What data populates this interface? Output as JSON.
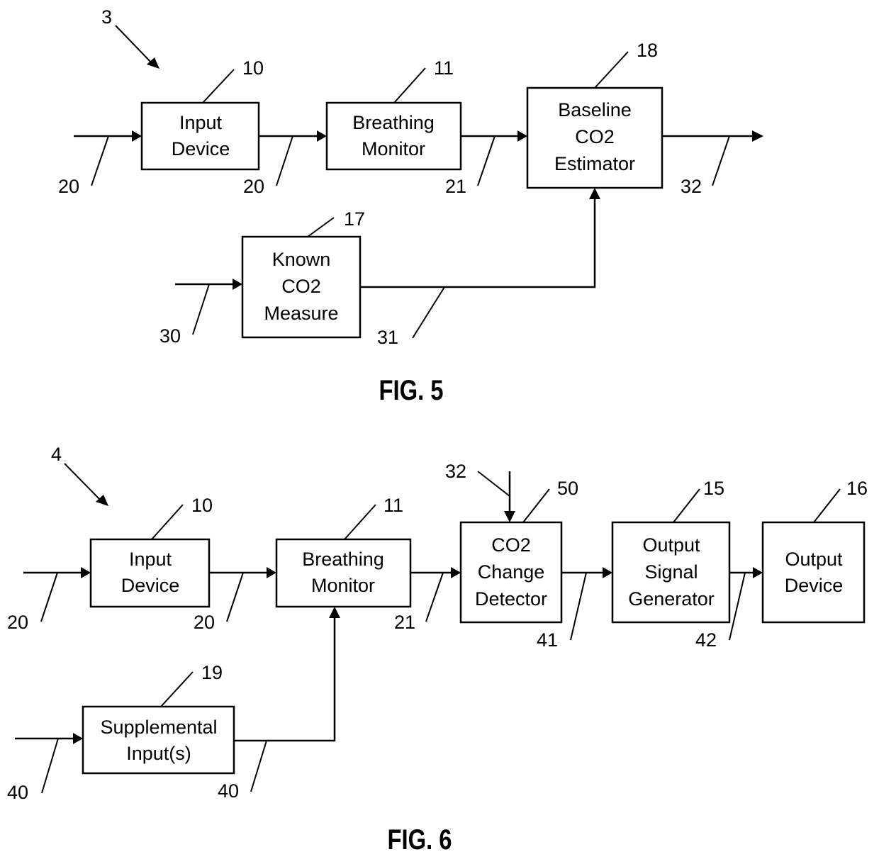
{
  "fig5": {
    "caption": "FIG. 5",
    "ref": "3",
    "blocks": {
      "input_device": {
        "ref": "10",
        "lines": [
          "Input",
          "Device"
        ]
      },
      "breathing_monitor": {
        "ref": "11",
        "lines": [
          "Breathing",
          "Monitor"
        ]
      },
      "baseline_estimator": {
        "ref": "18",
        "lines": [
          "Baseline",
          "CO2",
          "Estimator"
        ]
      },
      "known_co2": {
        "ref": "17",
        "lines": [
          "Known",
          "CO2",
          "Measure"
        ]
      }
    },
    "signals": {
      "in_input": "20",
      "input_to_monitor": "20",
      "monitor_to_estimator": "21",
      "estimator_out": "32",
      "in_known": "30",
      "known_to_estimator": "31"
    }
  },
  "fig6": {
    "caption": "FIG. 6",
    "ref": "4",
    "blocks": {
      "input_device": {
        "ref": "10",
        "lines": [
          "Input",
          "Device"
        ]
      },
      "breathing_monitor": {
        "ref": "11",
        "lines": [
          "Breathing",
          "Monitor"
        ]
      },
      "co2_change_detector": {
        "ref": "50",
        "lines": [
          "CO2",
          "Change",
          "Detector"
        ]
      },
      "output_signal_generator": {
        "ref": "15",
        "lines": [
          "Output",
          "Signal",
          "Generator"
        ]
      },
      "output_device": {
        "ref": "16",
        "lines": [
          "Output",
          "Device"
        ]
      },
      "supplemental_inputs": {
        "ref": "19",
        "lines": [
          "Supplemental",
          "Input(s)"
        ]
      }
    },
    "signals": {
      "in_input": "20",
      "input_to_monitor": "20",
      "monitor_to_detector": "21",
      "baseline_in": "32",
      "detector_to_generator": "41",
      "generator_to_output": "42",
      "in_supplemental": "40",
      "supplemental_to_monitor": "40"
    }
  }
}
